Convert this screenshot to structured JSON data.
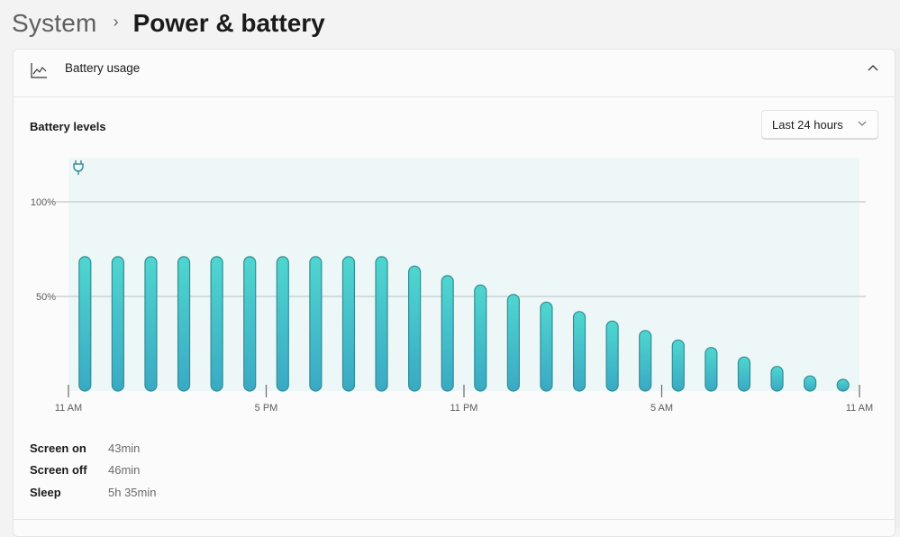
{
  "breadcrumb": {
    "parent": "System",
    "separator": "›",
    "current": "Power & battery"
  },
  "battery_usage": {
    "header_icon": "line-chart-icon",
    "title": "Battery usage",
    "collapse_icon": "chevron-up-icon",
    "levels_label": "Battery levels",
    "range_select": {
      "selected": "Last 24 hours",
      "icon": "chevron-down-icon"
    },
    "stats": [
      {
        "label": "Screen on",
        "value": "43min"
      },
      {
        "label": "Screen off",
        "value": "46min"
      },
      {
        "label": "Sleep",
        "value": "5h 35min"
      }
    ]
  },
  "colors": {
    "bar_top": "#4fd6cf",
    "bar_bottom": "#3aa9c4",
    "bar_stroke": "#2f8e96",
    "plot_bg": "#eef7f7",
    "charging_icon": "#3b8f95",
    "gridline": "#c9d3d3"
  },
  "chart_data": {
    "type": "bar",
    "title": "Battery levels",
    "xlabel": "",
    "ylabel": "",
    "ylim": [
      0,
      120
    ],
    "y_ticks": [
      {
        "value": 100,
        "label": "100%"
      },
      {
        "value": 50,
        "label": "50%"
      }
    ],
    "x_ticks": [
      "11 AM",
      "5 PM",
      "11 PM",
      "5 AM",
      "11 AM"
    ],
    "x_range_hours": [
      0,
      24
    ],
    "grid": true,
    "charging_marker_hour": 0.3,
    "charging_marker_icon": "plug-icon",
    "bar_hours": [
      0.5,
      1.5,
      2.5,
      3.5,
      4.5,
      5.5,
      6.5,
      7.5,
      8.5,
      9.5,
      10.5,
      11.5,
      12.5,
      13.5,
      14.5,
      15.5,
      16.5,
      17.5,
      18.5,
      19.5,
      20.5,
      21.5,
      22.5,
      23.5
    ],
    "values": [
      71,
      71,
      71,
      71,
      71,
      71,
      71,
      71,
      71,
      71,
      66,
      61,
      56,
      51,
      47,
      42,
      37,
      32,
      27,
      23,
      18,
      13,
      8,
      5
    ]
  }
}
